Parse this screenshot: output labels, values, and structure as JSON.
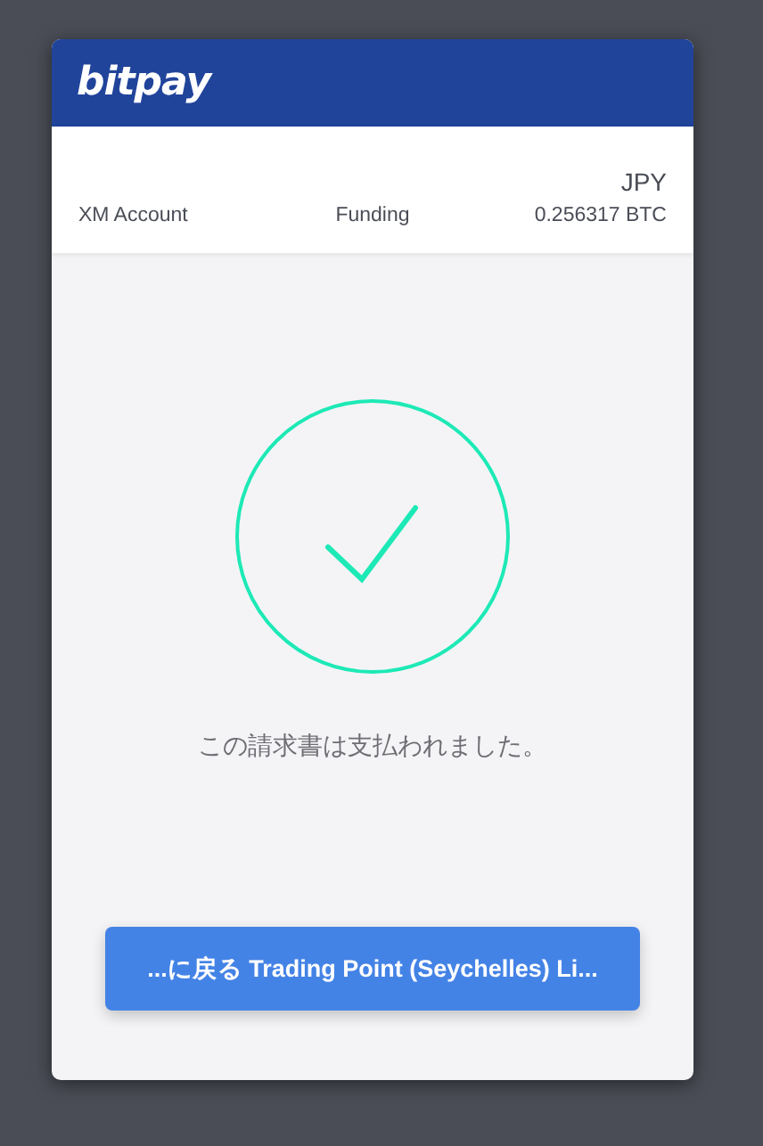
{
  "header": {
    "logo": "bitpay"
  },
  "summary": {
    "merchant": "XM Account",
    "item": "Funding",
    "fiat": "JPY",
    "crypto": "0.256317 BTC"
  },
  "status": {
    "kind": "paid",
    "message": "この請求書は支払われました。"
  },
  "return_button": {
    "label": "...に戻る Trading Point (Seychelles) Li..."
  }
}
